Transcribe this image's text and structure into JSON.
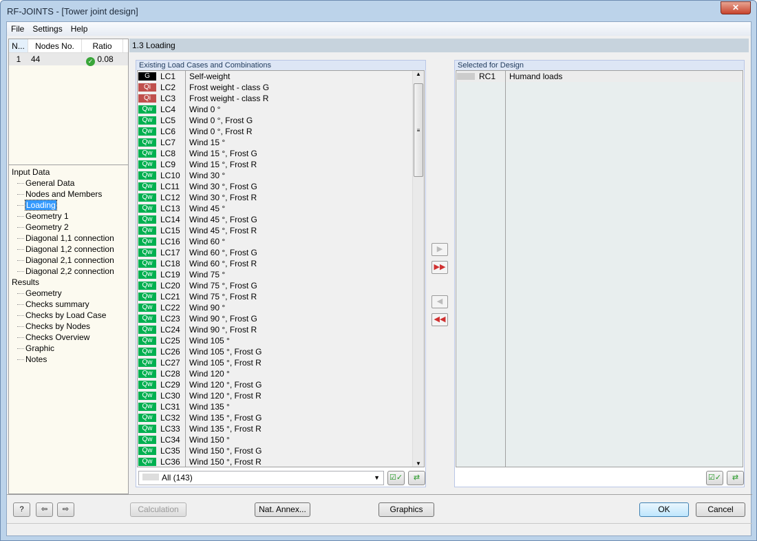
{
  "window": {
    "title": "RF-JOINTS - [Tower joint design]",
    "close": "✕"
  },
  "menu": [
    "File",
    "Settings",
    "Help"
  ],
  "nodes_table": {
    "headers": [
      "N...",
      "Nodes No.",
      "Ratio"
    ],
    "rows": [
      {
        "no": "1",
        "node": "44",
        "ratio": "0.08",
        "status": "ok-check-icon"
      }
    ]
  },
  "tree": {
    "input_label": "Input Data",
    "input_items": [
      "General Data",
      "Nodes and Members",
      "Loading",
      "Geometry 1",
      "Geometry 2",
      "Diagonal 1,1 connection",
      "Diagonal 1,2 connection",
      "Diagonal 2,1 connection",
      "Diagonal 2,2 connection"
    ],
    "selected": "Loading",
    "results_label": "Results",
    "results_items": [
      "Geometry",
      "Checks summary",
      "Checks by Load Case",
      "Checks by Nodes",
      "Checks Overview",
      "Graphic",
      "Notes"
    ]
  },
  "section_title": "1.3 Loading",
  "existing": {
    "title": "Existing Load Cases and Combinations",
    "badge_colors": {
      "G": "#000000",
      "Qi": "#c0504d",
      "Qw": "#00b050"
    },
    "rows": [
      [
        "G",
        "LC1",
        "Self-weight"
      ],
      [
        "Qi",
        "LC2",
        "Frost weight - class G"
      ],
      [
        "Qi",
        "LC3",
        "Frost weight - class R"
      ],
      [
        "Qw",
        "LC4",
        "Wind 0 °"
      ],
      [
        "Qw",
        "LC5",
        "Wind 0 °, Frost G"
      ],
      [
        "Qw",
        "LC6",
        "Wind 0 °, Frost R"
      ],
      [
        "Qw",
        "LC7",
        "Wind 15 °"
      ],
      [
        "Qw",
        "LC8",
        "Wind 15 °, Frost G"
      ],
      [
        "Qw",
        "LC9",
        "Wind 15 °, Frost R"
      ],
      [
        "Qw",
        "LC10",
        "Wind 30 °"
      ],
      [
        "Qw",
        "LC11",
        "Wind 30 °, Frost G"
      ],
      [
        "Qw",
        "LC12",
        "Wind 30 °, Frost R"
      ],
      [
        "Qw",
        "LC13",
        "Wind 45 °"
      ],
      [
        "Qw",
        "LC14",
        "Wind 45 °, Frost G"
      ],
      [
        "Qw",
        "LC15",
        "Wind 45 °, Frost R"
      ],
      [
        "Qw",
        "LC16",
        "Wind 60 °"
      ],
      [
        "Qw",
        "LC17",
        "Wind 60 °, Frost G"
      ],
      [
        "Qw",
        "LC18",
        "Wind 60 °, Frost R"
      ],
      [
        "Qw",
        "LC19",
        "Wind 75 °"
      ],
      [
        "Qw",
        "LC20",
        "Wind 75 °, Frost G"
      ],
      [
        "Qw",
        "LC21",
        "Wind 75 °, Frost R"
      ],
      [
        "Qw",
        "LC22",
        "Wind 90 °"
      ],
      [
        "Qw",
        "LC23",
        "Wind 90 °, Frost G"
      ],
      [
        "Qw",
        "LC24",
        "Wind 90 °, Frost R"
      ],
      [
        "Qw",
        "LC25",
        "Wind 105 °"
      ],
      [
        "Qw",
        "LC26",
        "Wind 105 °, Frost G"
      ],
      [
        "Qw",
        "LC27",
        "Wind 105 °, Frost R"
      ],
      [
        "Qw",
        "LC28",
        "Wind 120 °"
      ],
      [
        "Qw",
        "LC29",
        "Wind 120 °, Frost G"
      ],
      [
        "Qw",
        "LC30",
        "Wind 120 °, Frost R"
      ],
      [
        "Qw",
        "LC31",
        "Wind 135 °"
      ],
      [
        "Qw",
        "LC32",
        "Wind 135 °, Frost G"
      ],
      [
        "Qw",
        "LC33",
        "Wind 135 °, Frost R"
      ],
      [
        "Qw",
        "LC34",
        "Wind 150 °"
      ],
      [
        "Qw",
        "LC35",
        "Wind 150 °, Frost G"
      ],
      [
        "Qw",
        "LC36",
        "Wind 150 °, Frost R"
      ]
    ],
    "filter": "All (143)"
  },
  "selected": {
    "title": "Selected for Design",
    "rows": [
      [
        "RC1",
        "Humand loads"
      ]
    ]
  },
  "buttons": {
    "calculation": "Calculation",
    "nat_annex": "Nat. Annex...",
    "graphics": "Graphics",
    "ok": "OK",
    "cancel": "Cancel"
  }
}
